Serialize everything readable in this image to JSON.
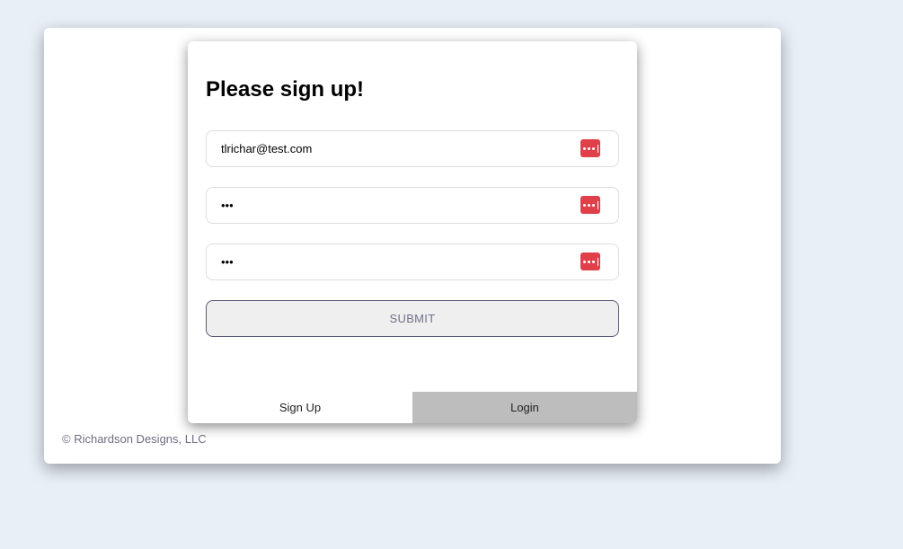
{
  "footer": {
    "copyright": "© Richardson Designs, LLC"
  },
  "modal": {
    "title": "Please sign up!",
    "fields": [
      {
        "value": "tlrichar@test.com",
        "icon": "password-manager-icon"
      },
      {
        "value": "•••",
        "icon": "password-manager-icon"
      },
      {
        "value": "•••",
        "icon": "password-manager-icon"
      }
    ],
    "submit_label": "SUBMIT",
    "tabs": [
      {
        "label": "Sign Up",
        "active": true
      },
      {
        "label": "Login",
        "active": false
      }
    ]
  },
  "colors": {
    "background": "#e8eff7",
    "icon_accent": "#e0404a",
    "inactive_tab": "#bdbdbd"
  }
}
